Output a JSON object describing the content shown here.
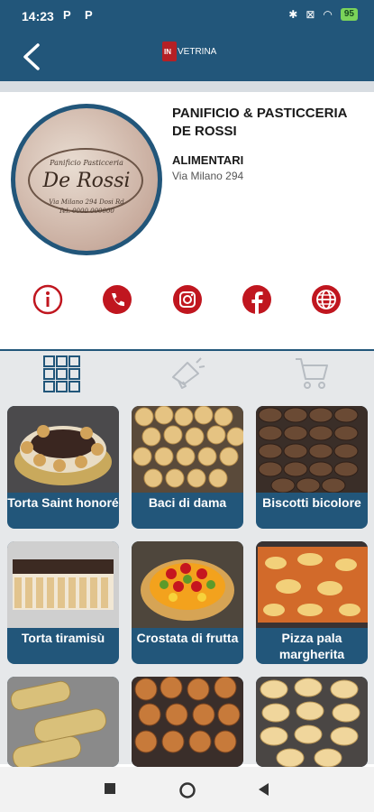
{
  "status": {
    "time": "14:23",
    "left_icons": "P P",
    "battery": "95"
  },
  "app": {
    "logo_text": "VETRINA",
    "logo_box": "IN"
  },
  "shop": {
    "name": "PANIFICIO & PASTICCERIA DE ROSSI",
    "category": "ALIMENTARI",
    "address": "Via Milano 294",
    "logo": {
      "line1": "Panificio Pasticceria",
      "line2": "De Rossi",
      "line3": "Via Milano 294 Dosi Rd",
      "line4": "Tel. 0000 000000"
    }
  },
  "actions": [
    "info-icon",
    "phone-icon",
    "instagram-icon",
    "facebook-icon",
    "globe-icon"
  ],
  "tabs": [
    "grid-icon",
    "megaphone-icon",
    "cart-icon"
  ],
  "products": [
    {
      "name": "Torta Saint honoré"
    },
    {
      "name": "Baci di dama"
    },
    {
      "name": "Biscotti bicolore"
    },
    {
      "name": "Torta tiramisù"
    },
    {
      "name": "Crostata di frutta"
    },
    {
      "name": "Pizza pala margherita"
    }
  ],
  "colors": {
    "primary": "#22567a",
    "accent": "#c0161f",
    "tabs_bg": "#e6e8ea"
  }
}
